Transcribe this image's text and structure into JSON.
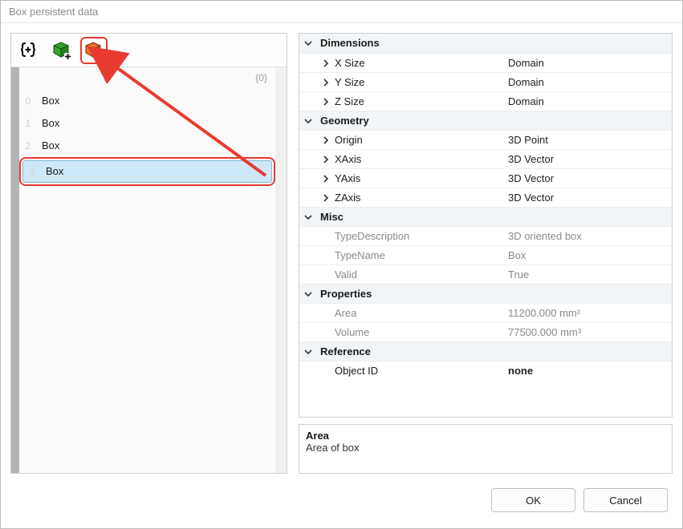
{
  "window": {
    "title": "Box persistent data"
  },
  "toolbar": {
    "icons": {
      "braces": {
        "name": "braces-plus-icon"
      },
      "addBox": {
        "name": "add-box-icon"
      },
      "delBox": {
        "name": "delete-box-icon"
      }
    }
  },
  "list": {
    "caption": "{0}",
    "rows": [
      {
        "index": "0",
        "label": "Box",
        "selected": false
      },
      {
        "index": "1",
        "label": "Box",
        "selected": false
      },
      {
        "index": "2",
        "label": "Box",
        "selected": false
      },
      {
        "index": "3",
        "label": "Box",
        "selected": true
      }
    ]
  },
  "props": {
    "groups": {
      "dimensions": {
        "header": "Dimensions",
        "items": [
          {
            "label": "X Size",
            "value": "Domain",
            "arrow": "right"
          },
          {
            "label": "Y Size",
            "value": "Domain",
            "arrow": "right"
          },
          {
            "label": "Z Size",
            "value": "Domain",
            "arrow": "right"
          }
        ]
      },
      "geometry": {
        "header": "Geometry",
        "items": [
          {
            "label": "Origin",
            "value": "3D Point",
            "arrow": "right"
          },
          {
            "label": "XAxis",
            "value": "3D Vector",
            "arrow": "right"
          },
          {
            "label": "YAxis",
            "value": "3D Vector",
            "arrow": "right"
          },
          {
            "label": "ZAxis",
            "value": "3D Vector",
            "arrow": "right"
          }
        ]
      },
      "misc": {
        "header": "Misc",
        "items": [
          {
            "label": "TypeDescription",
            "value": "3D oriented box",
            "muted": true
          },
          {
            "label": "TypeName",
            "value": "Box",
            "muted": true
          },
          {
            "label": "Valid",
            "value": "True",
            "muted": true
          }
        ]
      },
      "properties": {
        "header": "Properties",
        "items": [
          {
            "label": "Area",
            "value": "11200.000 mm²",
            "muted": true
          },
          {
            "label": "Volume",
            "value": "77500.000 mm³",
            "muted": true
          }
        ]
      },
      "reference": {
        "header": "Reference",
        "items": [
          {
            "label": "Object ID",
            "value": "none",
            "bold": true
          }
        ]
      }
    }
  },
  "desc": {
    "title": "Area",
    "text": "Area of box"
  },
  "footer": {
    "ok": "OK",
    "cancel": "Cancel"
  },
  "colors": {
    "highlight": "#e83a2f",
    "selectionBg": "#cfe8f7",
    "selectionBorder": "#7fb9d8"
  }
}
